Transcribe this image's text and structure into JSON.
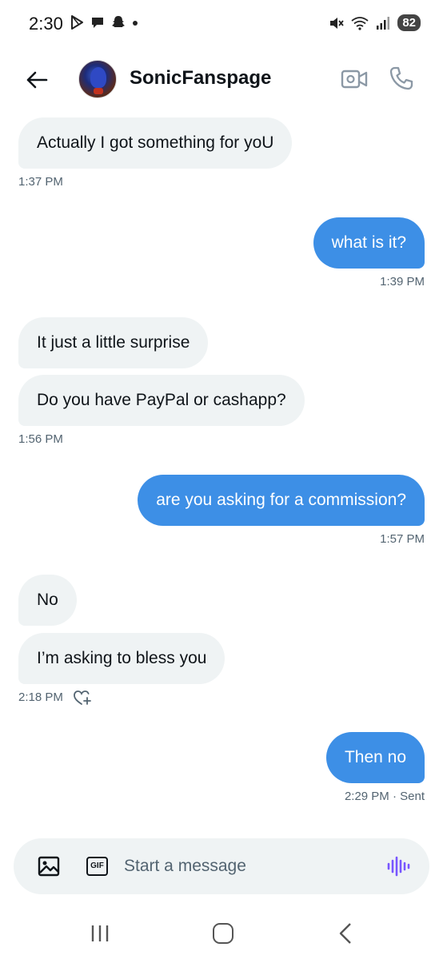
{
  "status_bar": {
    "time": "2:30",
    "battery": "82",
    "left_icons": [
      "play-store-icon",
      "chat-icon",
      "snapchat-icon",
      "dot-icon"
    ],
    "right_icons": [
      "mute-icon",
      "wifi-icon",
      "signal-icon"
    ]
  },
  "header": {
    "contact_name": "SonicFanspage",
    "back_icon": "arrow-left-icon",
    "video_icon": "video-camera-icon",
    "call_icon": "phone-icon"
  },
  "messages": [
    {
      "side": "in",
      "text": "Actually I got something for yoU"
    },
    {
      "side": "time-left",
      "text": "1:37 PM"
    },
    {
      "side": "out",
      "text": "what is it?"
    },
    {
      "side": "time-right",
      "text": "1:39 PM"
    },
    {
      "side": "in",
      "text": "It just a little surprise"
    },
    {
      "side": "in",
      "text": "Do you have PayPal or cashapp?"
    },
    {
      "side": "time-left",
      "text": "1:56 PM"
    },
    {
      "side": "out",
      "text": "are you asking for a commission?"
    },
    {
      "side": "time-right",
      "text": "1:57 PM"
    },
    {
      "side": "in",
      "text": "No"
    },
    {
      "side": "in",
      "text": "I’m asking to bless you"
    },
    {
      "side": "time-left",
      "text": "2:18 PM"
    },
    {
      "side": "out",
      "text": "Then no"
    },
    {
      "side": "time-right",
      "text": "2:29 PM · Sent"
    }
  ],
  "composer": {
    "placeholder": "Start a message",
    "gif_label": "GIF",
    "image_icon": "image-icon",
    "voice_icon": "voice-waveform-icon",
    "voice_color": "#7856ff"
  },
  "colors": {
    "outgoing_bubble": "#3d8fe6",
    "incoming_bubble": "#eff3f4",
    "timestamp": "#536471"
  },
  "nav_bar": {
    "recents_icon": "recent-apps-icon",
    "home_icon": "home-icon",
    "back_icon": "back-chevron-icon"
  }
}
